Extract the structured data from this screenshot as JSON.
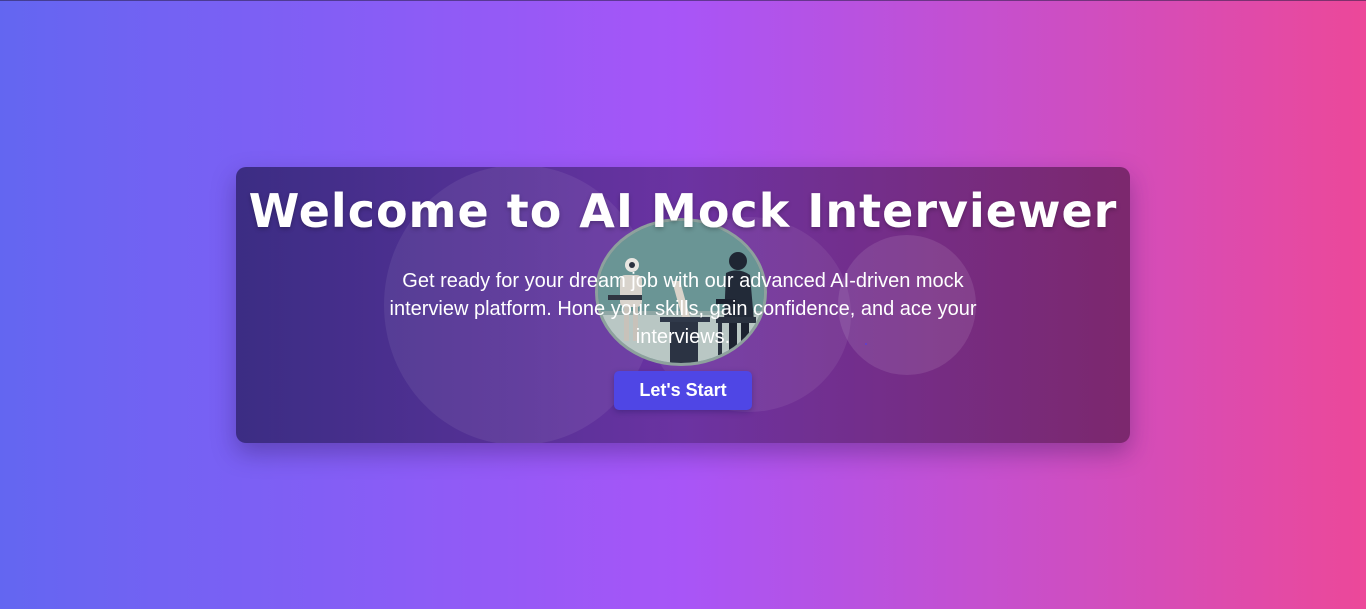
{
  "hero": {
    "title": "Welcome to AI Mock Interviewer",
    "subtitle": "Get ready for your dream job with our advanced AI-driven mock interview platform. Hone your skills, gain confidence, and ace your interviews.",
    "cta_label": "Let's Start",
    "illustration_icon": "interview-illustration-icon"
  },
  "colors": {
    "gradient_start": "#6366f1",
    "gradient_mid": "#a855f7",
    "gradient_end": "#ec4899",
    "button": "#4f46e5",
    "text": "#ffffff"
  }
}
